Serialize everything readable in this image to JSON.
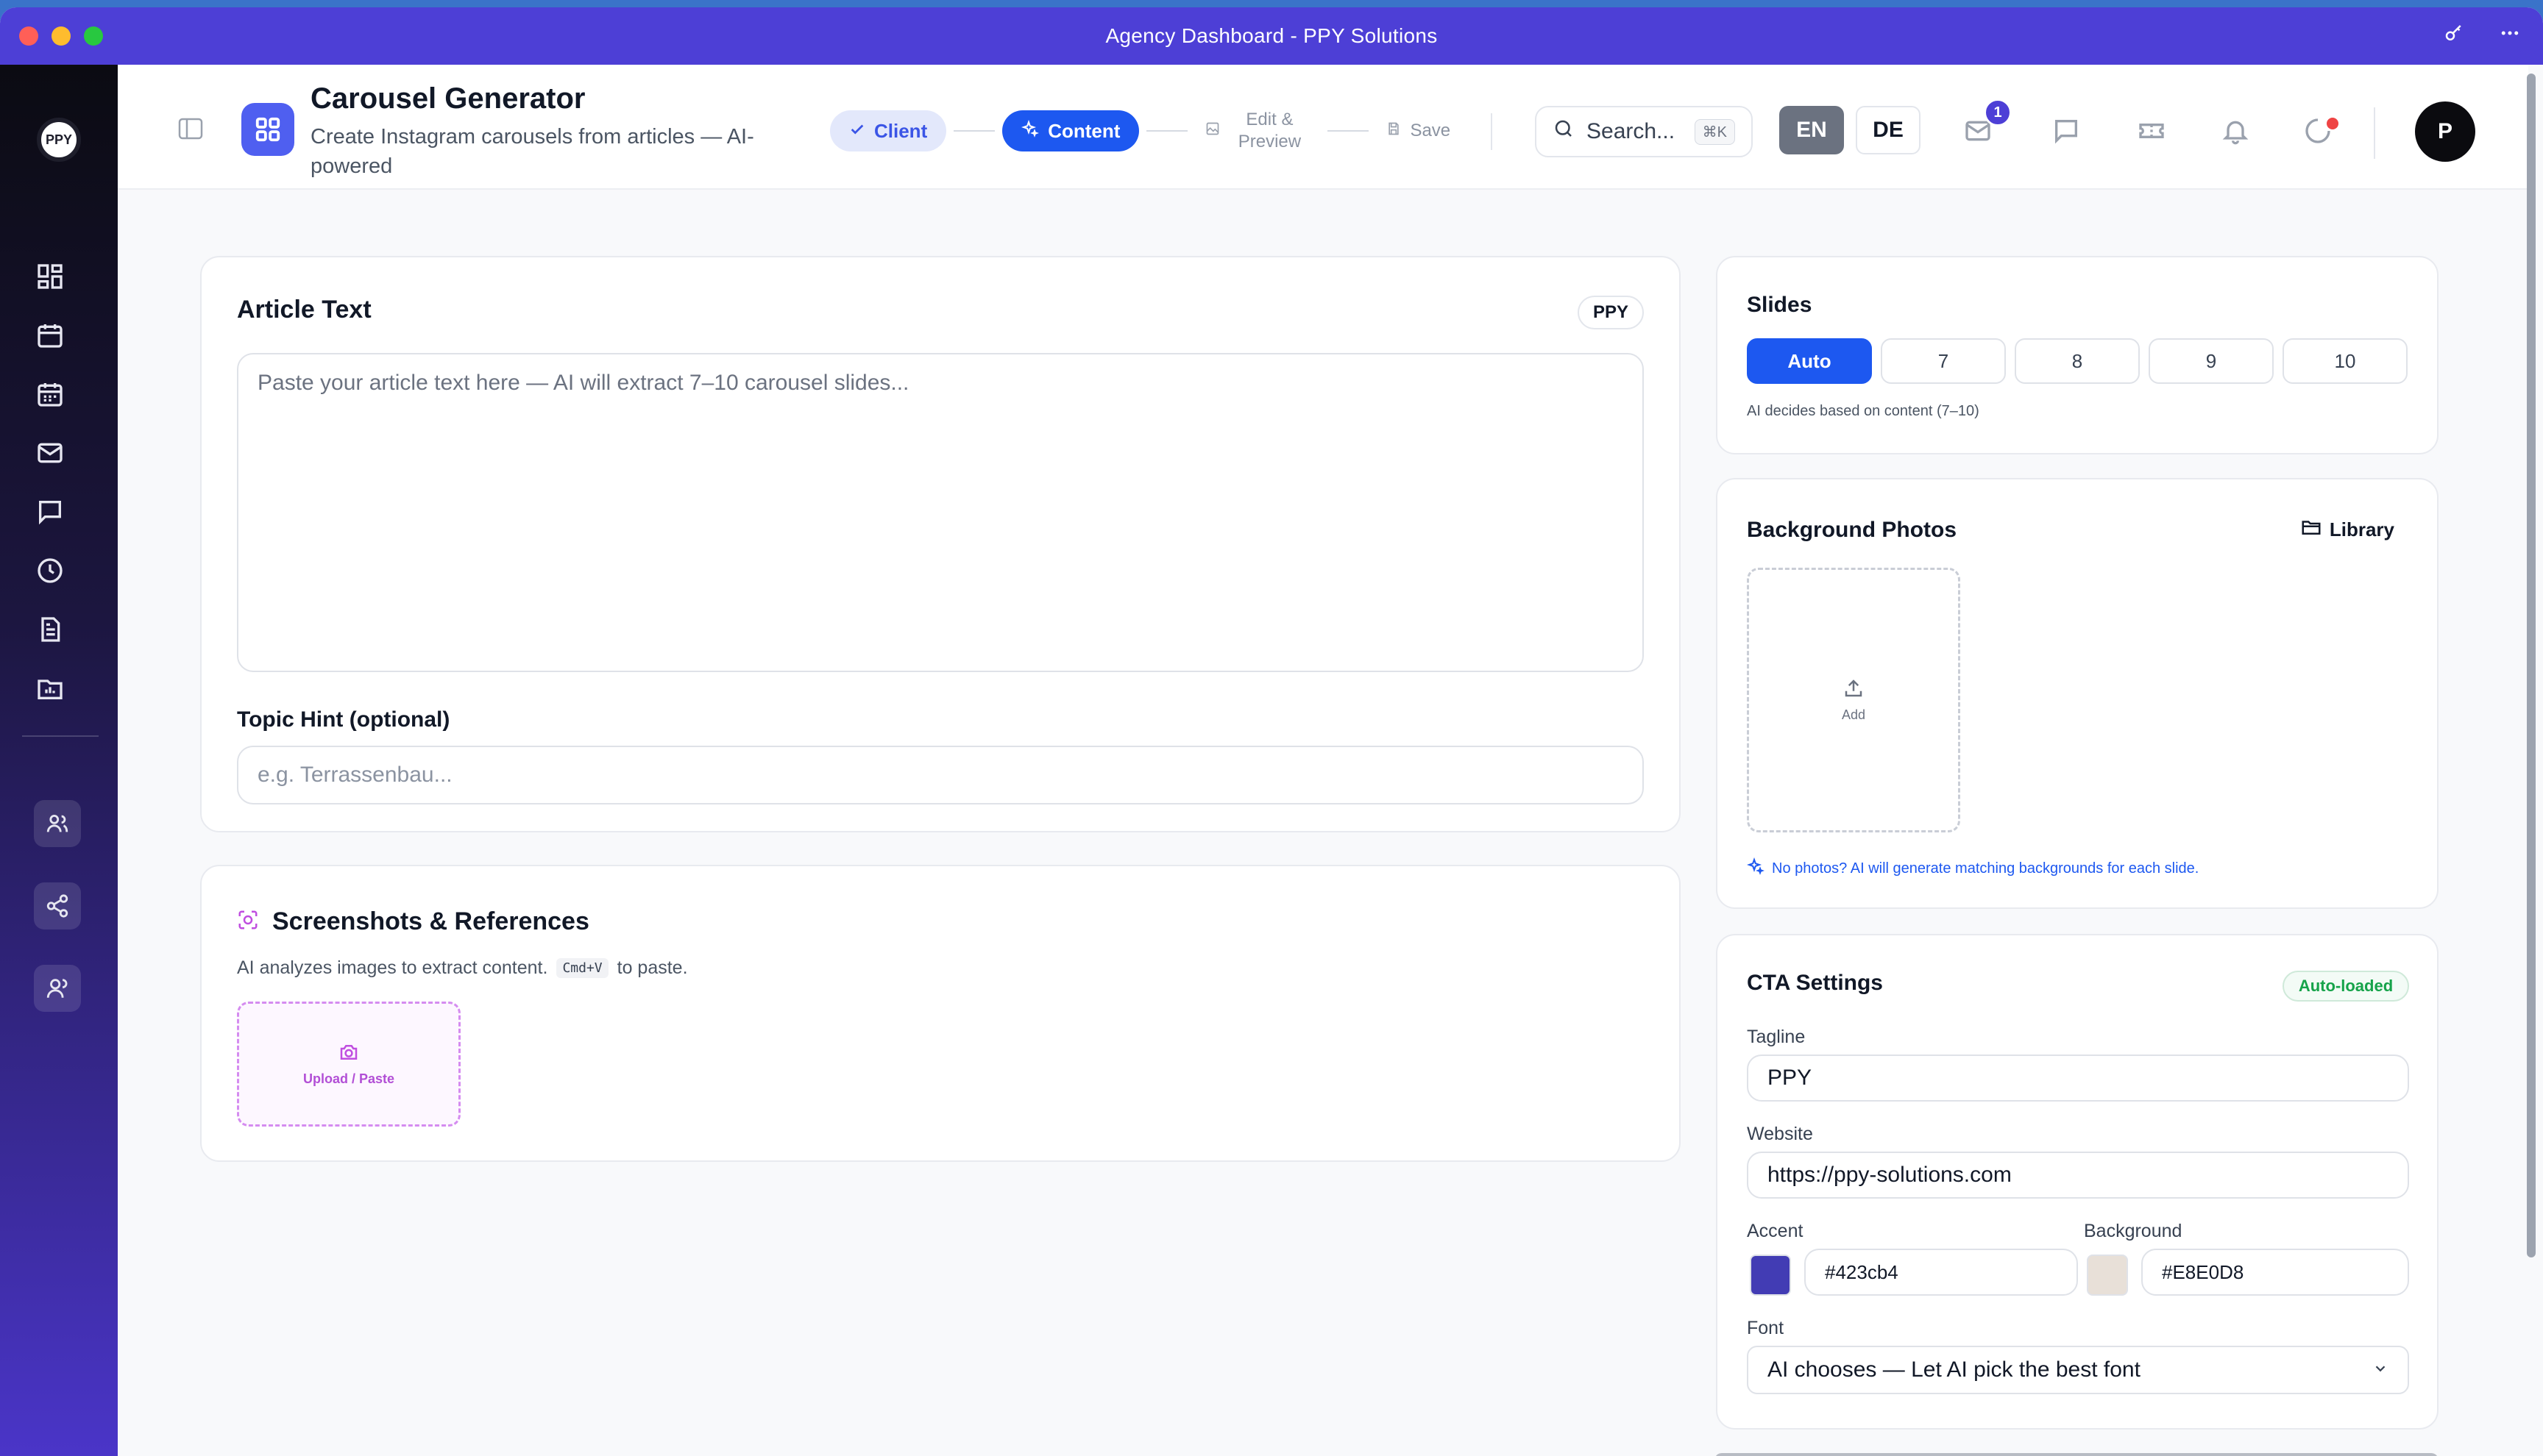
{
  "window": {
    "title": "Agency Dashboard - PPY Solutions"
  },
  "sidebar": {
    "logo_text": "PPY"
  },
  "header": {
    "title": "Carousel Generator",
    "subtitle": "Create Instagram carousels from articles — AI-powered",
    "steps": [
      {
        "label": "Client",
        "state": "done"
      },
      {
        "label": "Content",
        "state": "active"
      },
      {
        "label": "Edit & Preview",
        "state": "idle"
      },
      {
        "label": "Save",
        "state": "idle"
      }
    ],
    "search_placeholder": "Search...",
    "search_shortcut": "⌘K",
    "lang_en": "EN",
    "lang_de": "DE",
    "mail_badge": "1",
    "avatar_initial": "P"
  },
  "article": {
    "heading": "Article Text",
    "client_tag": "PPY",
    "textarea_placeholder": "Paste your article text here — AI will extract 7–10 carousel slides...",
    "topic_label": "Topic Hint (optional)",
    "topic_placeholder": "e.g. Terrassenbau..."
  },
  "screenshots": {
    "heading": "Screenshots & References",
    "desc_prefix": "AI analyzes images to extract content.",
    "desc_code": "Cmd+V",
    "desc_suffix": "to paste.",
    "upload_label": "Upload / Paste"
  },
  "slides": {
    "heading": "Slides",
    "options": [
      "Auto",
      "7",
      "8",
      "9",
      "10"
    ],
    "selected": "Auto",
    "hint": "AI decides based on content (7–10)"
  },
  "background_photos": {
    "heading": "Background Photos",
    "library_label": "Library",
    "add_label": "Add",
    "note": "No photos? AI will generate matching backgrounds for each slide."
  },
  "cta": {
    "heading": "CTA Settings",
    "status_badge": "Auto-loaded",
    "tagline_label": "Tagline",
    "tagline_value": "PPY",
    "website_label": "Website",
    "website_value": "https://ppy-solutions.com",
    "accent_label": "Accent",
    "accent_value": "#423cb4",
    "background_label": "Background",
    "background_value": "#E8E0D8",
    "font_label": "Font",
    "font_value": "AI chooses — Let AI pick the best font"
  },
  "colors": {
    "brand_purple": "#4d3fd6",
    "primary_blue": "#1d58f0",
    "accent_swatch": "#423cb4",
    "background_swatch": "#E8E0D8"
  }
}
